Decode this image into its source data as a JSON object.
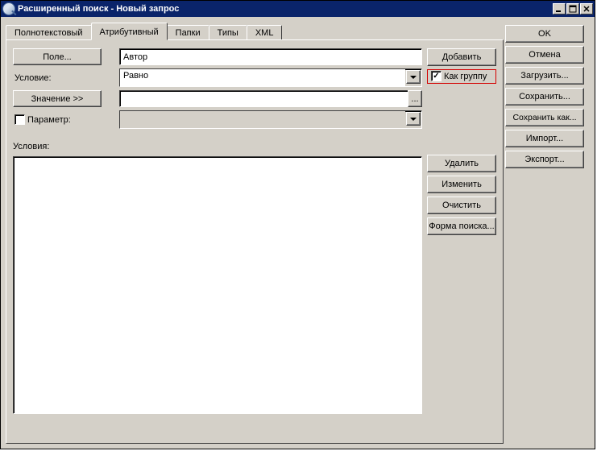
{
  "window": {
    "title": "Расширенный поиск - Новый запрос"
  },
  "tabs": {
    "fulltext": "Полнотекстовый",
    "attribute": "Атрибутивный",
    "folders": "Папки",
    "types": "Типы",
    "xml": "XML"
  },
  "form": {
    "field_btn": "Поле...",
    "field_value": "Автор",
    "condition_label": "Условие:",
    "condition_value": "Равно",
    "value_btn": "Значение >>",
    "value_value": "",
    "ellipsis": "...",
    "parameter_label": "Параметр:",
    "parameter_value": "",
    "conditions_label": "Условия:"
  },
  "sidepanel": {
    "add": "Добавить",
    "as_group": "Как группу",
    "delete": "Удалить",
    "edit": "Изменить",
    "clear": "Очистить",
    "search_form": "Форма поиска..."
  },
  "right": {
    "ok": "OK",
    "cancel": "Отмена",
    "load": "Загрузить...",
    "save": "Сохранить...",
    "saveas": "Сохранить как...",
    "import": "Импорт...",
    "export": "Экспорт..."
  }
}
